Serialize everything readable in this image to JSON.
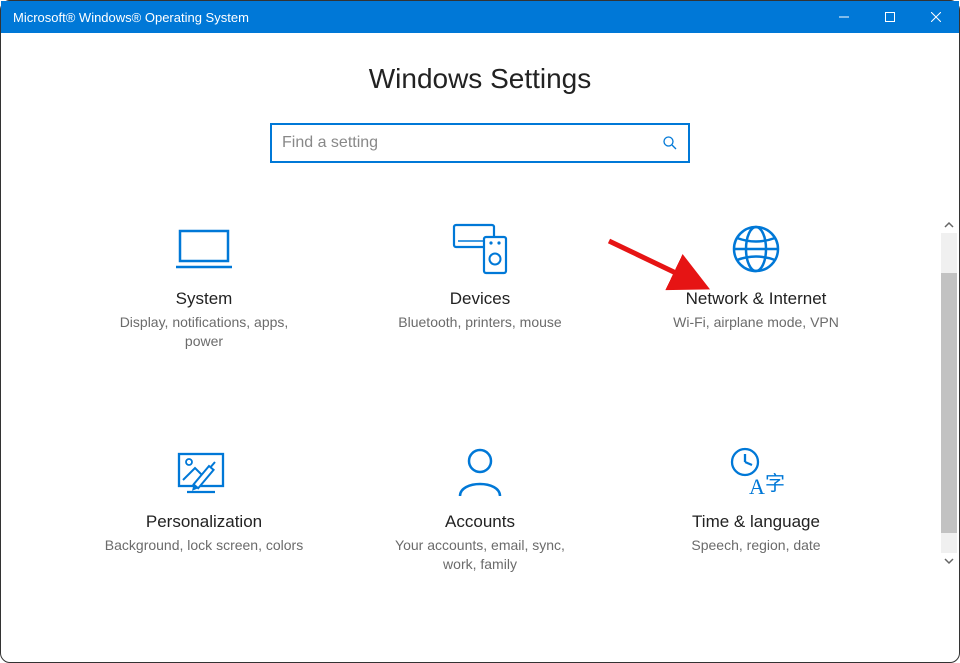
{
  "window": {
    "title": "Microsoft® Windows® Operating System"
  },
  "header": {
    "title": "Windows Settings"
  },
  "search": {
    "placeholder": "Find a setting",
    "value": ""
  },
  "tiles": [
    {
      "id": "system",
      "title": "System",
      "desc": "Display, notifications, apps, power"
    },
    {
      "id": "devices",
      "title": "Devices",
      "desc": "Bluetooth, printers, mouse"
    },
    {
      "id": "network",
      "title": "Network & Internet",
      "desc": "Wi-Fi, airplane mode, VPN"
    },
    {
      "id": "personalization",
      "title": "Personalization",
      "desc": "Background, lock screen, colors"
    },
    {
      "id": "accounts",
      "title": "Accounts",
      "desc": "Your accounts, email, sync, work, family"
    },
    {
      "id": "time",
      "title": "Time & language",
      "desc": "Speech, region, date"
    }
  ],
  "colors": {
    "accent": "#0078d7",
    "arrow": "#e61414"
  }
}
